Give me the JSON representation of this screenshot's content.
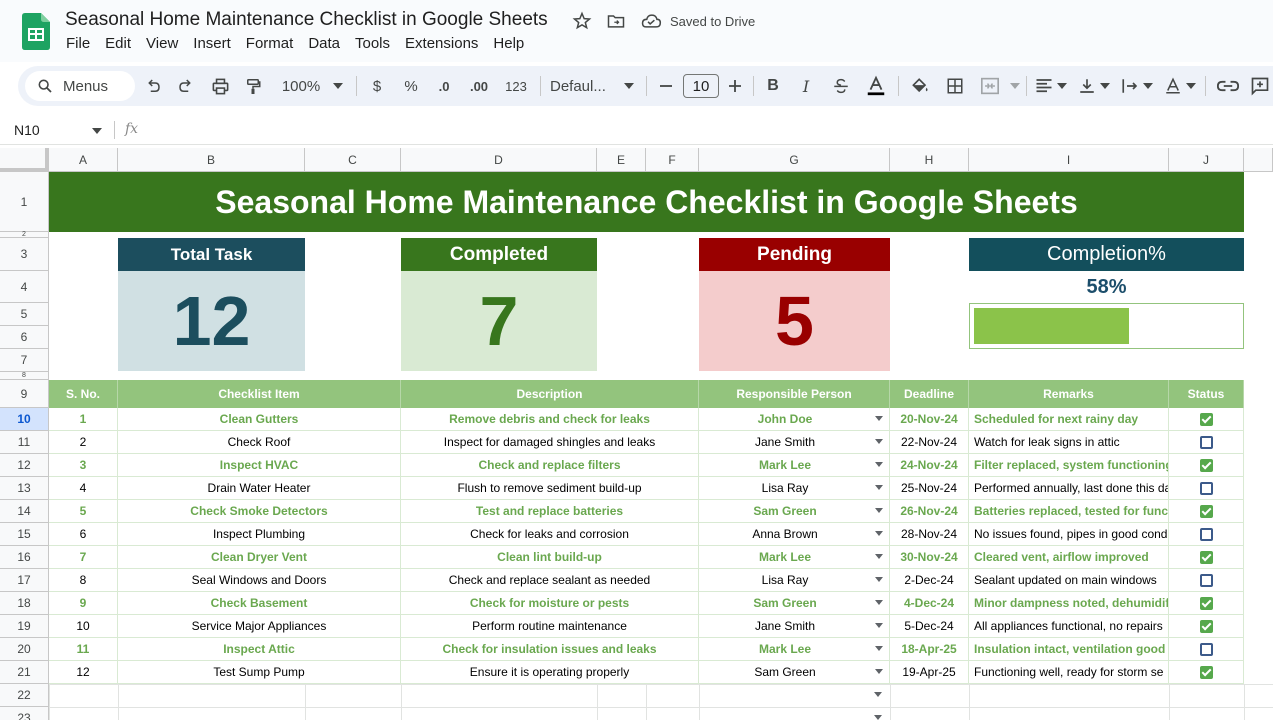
{
  "app": {
    "doc_title": "Seasonal Home Maintenance Checklist in Google Sheets",
    "saved_status": "Saved to Drive",
    "menu": [
      "File",
      "Edit",
      "View",
      "Insert",
      "Format",
      "Data",
      "Tools",
      "Extensions",
      "Help"
    ]
  },
  "toolbar": {
    "menus_label": "Menus",
    "zoom": "100%",
    "currency": "$",
    "percent": "%",
    "decrease_decimal": ".0",
    "increase_decimal": ".00",
    "number_format": "123",
    "font": "Defaul...",
    "font_size": "10"
  },
  "formula_bar": {
    "cell_ref": "N10",
    "fx": "fx"
  },
  "columns": [
    "A",
    "B",
    "C",
    "D",
    "E",
    "F",
    "G",
    "H",
    "I",
    "J"
  ],
  "rows": [
    "1",
    "2",
    "3",
    "4",
    "5",
    "6",
    "7",
    "8",
    "9",
    "10",
    "11",
    "12",
    "13",
    "14",
    "15",
    "16",
    "17",
    "18",
    "19",
    "20",
    "21",
    "22",
    "23"
  ],
  "banner": "Seasonal Home Maintenance Checklist in Google Sheets",
  "kpis": {
    "total": {
      "label": "Total Task",
      "value": "12"
    },
    "completed": {
      "label": "Completed",
      "value": "7"
    },
    "pending": {
      "label": "Pending",
      "value": "5"
    },
    "completion": {
      "label": "Completion%",
      "value": "58%",
      "fraction": 0.58
    }
  },
  "table": {
    "headers": [
      "S. No.",
      "Checklist Item",
      "Description",
      "Responsible Person",
      "Deadline",
      "Remarks",
      "Status"
    ],
    "rows": [
      {
        "sno": "1",
        "item": "Clean Gutters",
        "desc": "Remove debris and check for leaks",
        "person": "John Doe",
        "deadline": "20-Nov-24",
        "remarks": "Scheduled for next rainy day",
        "done": true
      },
      {
        "sno": "2",
        "item": "Check Roof",
        "desc": "Inspect for damaged shingles and leaks",
        "person": "Jane Smith",
        "deadline": "22-Nov-24",
        "remarks": "Watch for leak signs in attic",
        "done": false
      },
      {
        "sno": "3",
        "item": "Inspect HVAC",
        "desc": "Check and replace filters",
        "person": "Mark Lee",
        "deadline": "24-Nov-24",
        "remarks": "Filter replaced, system functioning w",
        "done": true
      },
      {
        "sno": "4",
        "item": "Drain Water Heater",
        "desc": "Flush to remove sediment build-up",
        "person": "Lisa Ray",
        "deadline": "25-Nov-24",
        "remarks": "Performed annually, last done this date",
        "done": false
      },
      {
        "sno": "5",
        "item": "Check Smoke Detectors",
        "desc": "Test and replace batteries",
        "person": "Sam Green",
        "deadline": "26-Nov-24",
        "remarks": "Batteries replaced, tested for functio",
        "done": true
      },
      {
        "sno": "6",
        "item": "Inspect Plumbing",
        "desc": "Check for leaks and corrosion",
        "person": "Anna Brown",
        "deadline": "28-Nov-24",
        "remarks": "No issues found, pipes in good conditi",
        "done": false
      },
      {
        "sno": "7",
        "item": "Clean Dryer Vent",
        "desc": "Clean lint build-up",
        "person": "Mark Lee",
        "deadline": "30-Nov-24",
        "remarks": "Cleared vent, airflow improved",
        "done": true
      },
      {
        "sno": "8",
        "item": "Seal Windows and Doors",
        "desc": "Check and replace sealant as needed",
        "person": "Lisa Ray",
        "deadline": "2-Dec-24",
        "remarks": "Sealant updated on main windows",
        "done": false
      },
      {
        "sno": "9",
        "item": "Check Basement",
        "desc": "Check for moisture or pests",
        "person": "Sam Green",
        "deadline": "4-Dec-24",
        "remarks": "Minor dampness noted, dehumidifie",
        "done": true
      },
      {
        "sno": "10",
        "item": "Service Major Appliances",
        "desc": "Perform routine maintenance",
        "person": "Jane Smith",
        "deadline": "5-Dec-24",
        "remarks": "All appliances functional, no repairs",
        "done": true
      },
      {
        "sno": "11",
        "item": "Inspect Attic",
        "desc": "Check for insulation issues and leaks",
        "person": "Mark Lee",
        "deadline": "18-Apr-25",
        "remarks": "Insulation intact, ventilation good",
        "done": false
      },
      {
        "sno": "12",
        "item": "Test Sump Pump",
        "desc": "Ensure it is operating properly",
        "person": "Sam Green",
        "deadline": "19-Apr-25",
        "remarks": "Functioning well, ready for storm se",
        "done": true
      }
    ]
  }
}
